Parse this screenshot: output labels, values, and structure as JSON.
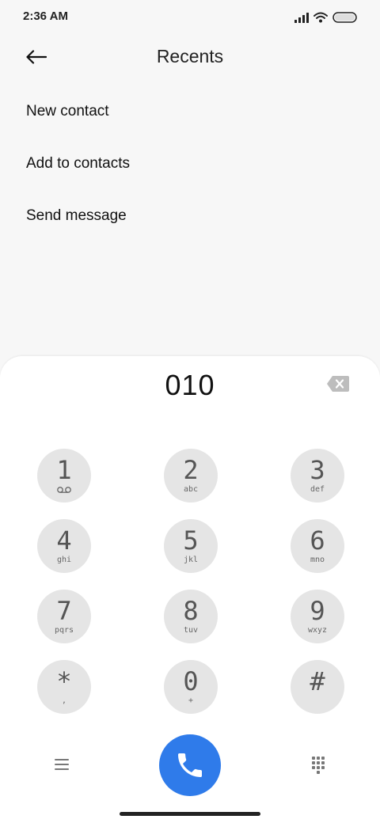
{
  "status": {
    "time": "2:36 AM",
    "icons": [
      "signal-icon",
      "wifi-icon",
      "battery-icon"
    ]
  },
  "header": {
    "title": "Recents",
    "back_icon": "back-arrow-icon"
  },
  "menu": {
    "items": [
      {
        "label": "New contact"
      },
      {
        "label": "Add to contacts"
      },
      {
        "label": "Send message"
      }
    ]
  },
  "dialer": {
    "number": "010",
    "backspace_icon": "backspace-icon",
    "keys": [
      {
        "digit": "1",
        "letters": "",
        "sub_icon": "voicemail-icon"
      },
      {
        "digit": "2",
        "letters": "abc"
      },
      {
        "digit": "3",
        "letters": "def"
      },
      {
        "digit": "4",
        "letters": "ghi"
      },
      {
        "digit": "5",
        "letters": "jkl"
      },
      {
        "digit": "6",
        "letters": "mno"
      },
      {
        "digit": "7",
        "letters": "pqrs"
      },
      {
        "digit": "8",
        "letters": "tuv"
      },
      {
        "digit": "9",
        "letters": "wxyz"
      },
      {
        "digit": "*",
        "letters": ","
      },
      {
        "digit": "0",
        "letters": "+"
      },
      {
        "digit": "#",
        "letters": ""
      }
    ],
    "bottom": {
      "menu_icon": "hamburger-menu-icon",
      "call_icon": "phone-icon",
      "grid_icon": "dialpad-grid-icon"
    }
  },
  "colors": {
    "background": "#f7f7f7",
    "dialer_bg": "#ffffff",
    "key_bg": "#e5e5e5",
    "call_button": "#2f7bea"
  }
}
